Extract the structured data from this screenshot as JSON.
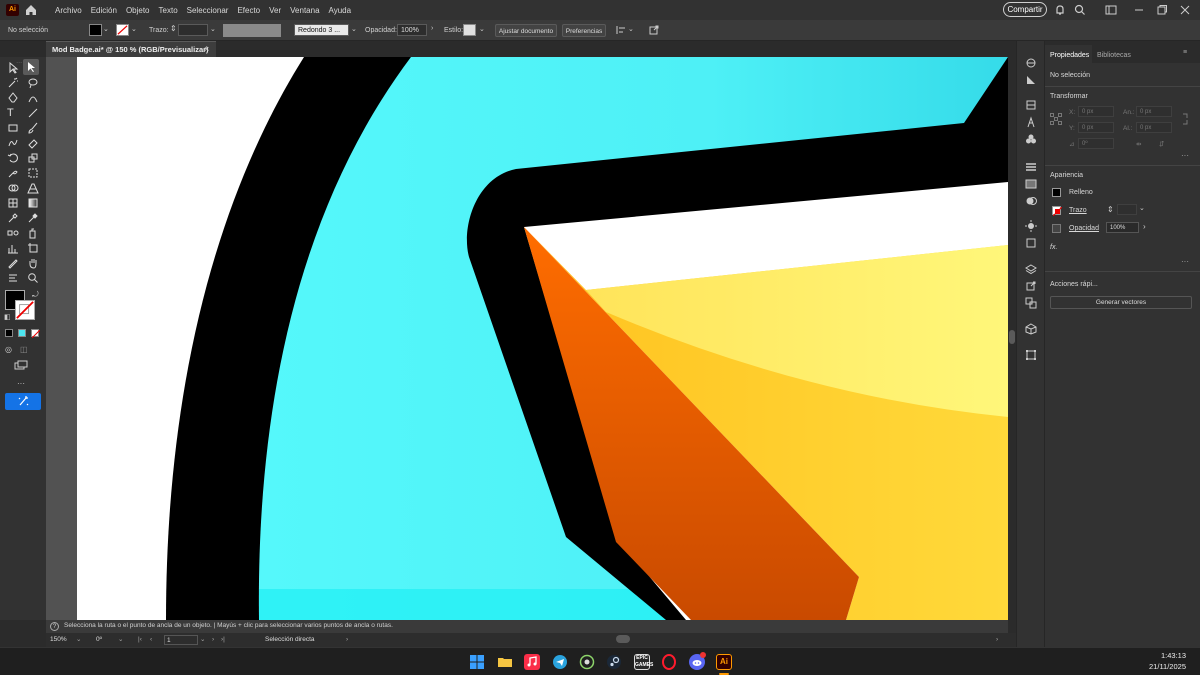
{
  "app": {
    "logo": "Ai",
    "share_label": "Compartir"
  },
  "menu": [
    "Archivo",
    "Edición",
    "Objeto",
    "Texto",
    "Seleccionar",
    "Efecto",
    "Ver",
    "Ventana",
    "Ayuda"
  ],
  "control": {
    "selection_label": "No selección",
    "stroke_label": "Trazo:",
    "brush_label": "Redondo 3 ...",
    "opacity_label": "Opacidad:",
    "opacity_value": "100%",
    "style_label": "Estilo:",
    "adjust_button": "Ajustar documento",
    "prefs_button": "Preferencias"
  },
  "document": {
    "tab_title": "Mod Badge.ai* @ 150 % (RGB/Previsualizar)",
    "close": "×"
  },
  "status": {
    "hint": "Selecciona la ruta o el punto de ancla de un objeto.  |  Mayús + clic para seleccionar varios puntos de ancla o rutas.",
    "zoom": "150%",
    "rotation": "0º",
    "artboard": "1",
    "tool": "Selección directa"
  },
  "panel": {
    "tabs": [
      "Propiedades",
      "Bibliotecas"
    ],
    "selection_label": "No selección",
    "transform_title": "Transformar",
    "x_label": "X:",
    "y_label": "Y:",
    "w_label": "An.:",
    "h_label": "Al.:",
    "x_value": "0 px",
    "y_value": "0 px",
    "w_value": "0 px",
    "h_value": "0 px",
    "angle_value": "0º",
    "appearance_title": "Apariencia",
    "fill_label": "Relleno",
    "stroke_label": "Trazo",
    "opacity_label": "Opacidad",
    "opacity_value": "100%",
    "fx_label": "fx.",
    "quick_actions_title": "Acciones rápi...",
    "generate_button": "Generar vectores"
  },
  "taskbar": {
    "time": "1:43:13",
    "date": "21/11/2025"
  },
  "colors": {
    "cyan": "#4df5f5",
    "black": "#000000",
    "orange": "#e06a00",
    "yellow": "#ffd83a",
    "white": "#ffffff"
  }
}
